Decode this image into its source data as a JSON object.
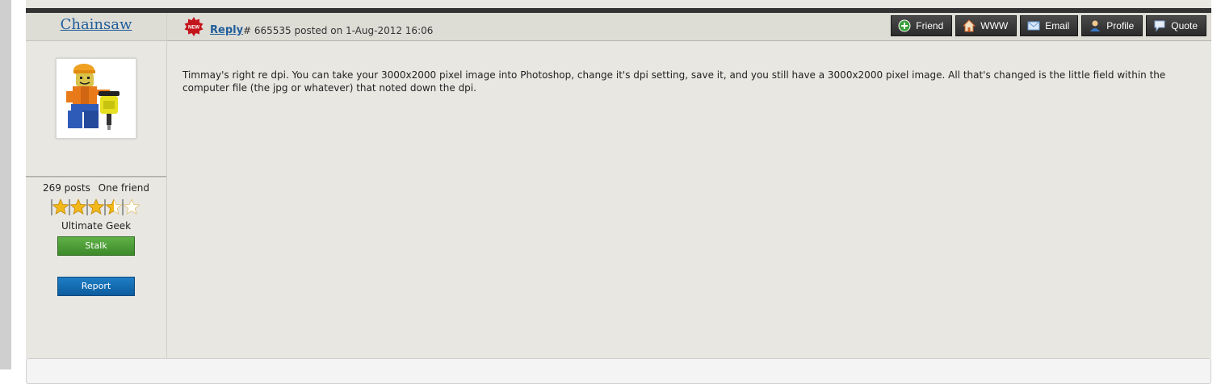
{
  "user": {
    "name": "Chainsaw",
    "posts": "269 posts",
    "friends": "One friend",
    "rank": "Ultimate Geek",
    "stars_filled": 3.5,
    "stars_total": 5
  },
  "buttons": {
    "stalk": "Stalk",
    "report": "Report"
  },
  "post": {
    "reply_label": "Reply",
    "meta": "# 665535 posted on 1-Aug-2012 16:06",
    "body": "Timmay's right re dpi. You can take your 3000x2000 pixel image into Photoshop, change it's dpi setting, save it, and you still have a 3000x2000 pixel image. All that's changed is the little field within the computer file (the jpg or whatever) that noted down the dpi."
  },
  "actions": [
    {
      "label": "Friend",
      "icon": "add-friend-icon"
    },
    {
      "label": "WWW",
      "icon": "home-icon"
    },
    {
      "label": "Email",
      "icon": "envelope-icon"
    },
    {
      "label": "Profile",
      "icon": "user-icon"
    },
    {
      "label": "Quote",
      "icon": "speech-bubble-icon"
    }
  ],
  "colors": {
    "link": "#1f5d9a",
    "stalk": "#4a9a35",
    "report": "#1468ad",
    "action_bg": "#333333"
  }
}
